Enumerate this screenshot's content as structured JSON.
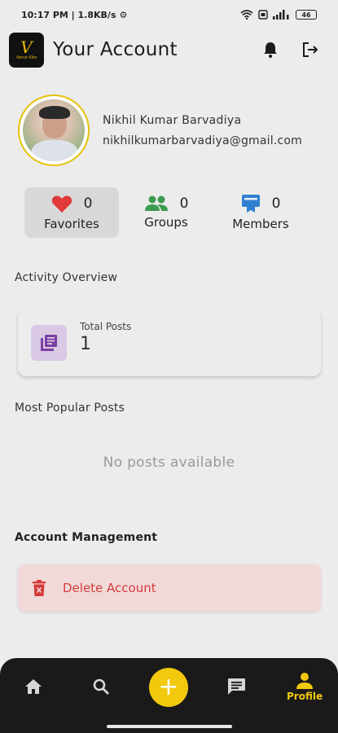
{
  "status_bar": {
    "time_speed": "10:17 PM | 1.8KB/s",
    "battery": "46"
  },
  "header": {
    "title": "Your Account",
    "logo_letter": "V",
    "logo_sub": "Verse Kite"
  },
  "profile": {
    "name": "Nikhil Kumar Barvadiya",
    "email": "nikhilkumarbarvadiya@gmail.com"
  },
  "stats": [
    {
      "label": "Favorites",
      "count": "0",
      "icon": "heart-icon",
      "color": "#e03a3a"
    },
    {
      "label": "Groups",
      "count": "0",
      "icon": "people-icon",
      "color": "#3d9b4f"
    },
    {
      "label": "Members",
      "count": "0",
      "icon": "card-membership-icon",
      "color": "#2f7fd1"
    }
  ],
  "activity": {
    "title": "Activity Overview",
    "total_posts_label": "Total Posts",
    "total_posts_value": "1"
  },
  "popular": {
    "title": "Most Popular Posts",
    "empty": "No posts available"
  },
  "account": {
    "title": "Account Management",
    "delete_label": "Delete Account"
  },
  "nav": {
    "profile_label": "Profile"
  },
  "colors": {
    "accent": "#f2c90d",
    "danger": "#d43b3b",
    "danger_bg": "#f2d9d9",
    "nav_bg": "#1a1a1a"
  }
}
